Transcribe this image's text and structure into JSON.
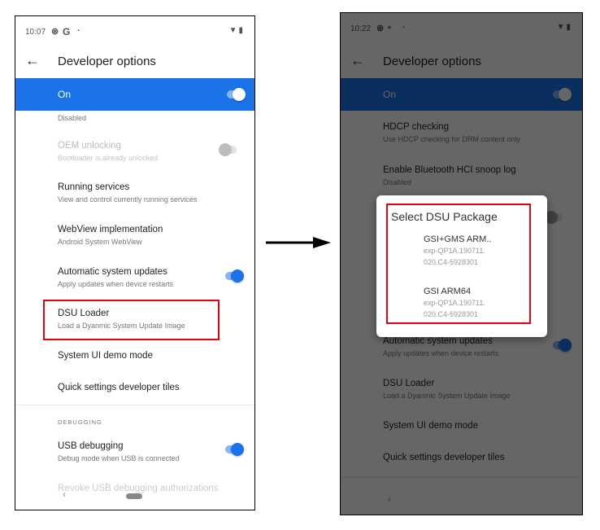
{
  "colors": {
    "accent": "#1a73e8",
    "highlight": "#e8000b",
    "toggle_track_on": "#8ab4f8",
    "toggle_off_thumb": "#9e9e9e"
  },
  "left_screen": {
    "status": {
      "time": "10:07",
      "icons": [
        "sync-icon",
        "google-icon",
        "dot-icon"
      ],
      "g_glyph": "G",
      "right_icons": [
        "wifi-icon",
        "battery-icon"
      ]
    },
    "app_bar": {
      "back": "←",
      "title": "Developer options"
    },
    "master_switch": {
      "label": "On",
      "state": true
    },
    "partial_top_summary": "Disabled",
    "items": [
      {
        "title": "OEM unlocking",
        "summary": "Bootloader is already unlocked",
        "toggle": false,
        "disabled": true
      },
      {
        "title": "Running services",
        "summary": "View and control currently running services"
      },
      {
        "title": "WebView implementation",
        "summary": "Android System WebView"
      },
      {
        "title": "Automatic system updates",
        "summary": "Apply updates when device restarts",
        "toggle": true
      },
      {
        "title": "DSU Loader",
        "summary": "Load a Dyanmic System Update Image",
        "highlighted": true
      },
      {
        "title": "System UI demo mode"
      },
      {
        "title": "Quick settings developer tiles"
      }
    ],
    "section": "DEBUGGING",
    "debug_items": [
      {
        "title": "USB debugging",
        "summary": "Debug mode when USB is connected",
        "toggle": true
      },
      {
        "title": "Revoke USB debugging authorizations"
      }
    ],
    "nav": {
      "back": "‹"
    }
  },
  "right_screen": {
    "status": {
      "time": "10:22",
      "icons": [
        "sync-icon",
        "image-icon",
        "dot-icon"
      ],
      "right_icons": [
        "wifi-icon",
        "battery-icon"
      ]
    },
    "app_bar": {
      "back": "←",
      "title": "Developer options"
    },
    "master_switch": {
      "label": "On",
      "state": true
    },
    "items": [
      {
        "title": "HDCP checking",
        "summary": "Use HDCP checking for DRM content only"
      },
      {
        "title": "Enable Bluetooth HCI snoop log",
        "summary": "Disabled"
      },
      {
        "title": "Automatic system updates",
        "summary": "Apply updates when device restarts",
        "toggle": true
      },
      {
        "title": "DSU Loader",
        "summary": "Load a Dyanmic System Update Image"
      },
      {
        "title": "System UI demo mode"
      },
      {
        "title": "Quick settings developer tiles"
      }
    ],
    "dialog": {
      "title": "Select DSU Package",
      "options": [
        {
          "name": "GSI+GMS ARM..",
          "version_line1": "exp-QP1A.190711.",
          "version_line2": "020.C4-5928301"
        },
        {
          "name": "GSI ARM64",
          "version_line1": "exp-QP1A.190711.",
          "version_line2": "020.C4-5928301"
        }
      ]
    },
    "nav": {
      "back": "‹"
    }
  }
}
